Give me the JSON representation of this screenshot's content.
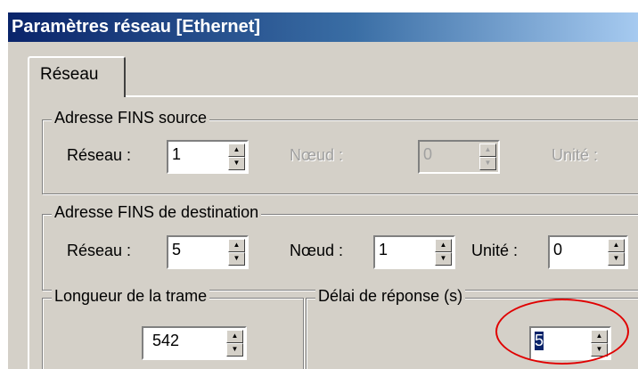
{
  "window": {
    "title": "Paramètres réseau [Ethernet]"
  },
  "tabs": [
    {
      "label": "Réseau",
      "active": true
    }
  ],
  "source_group": {
    "legend": "Adresse FINS source",
    "network_label": "Réseau :",
    "network_value": "1",
    "node_label": "Nœud :",
    "node_value": "0",
    "unit_label": "Unité :"
  },
  "dest_group": {
    "legend": "Adresse FINS de destination",
    "network_label": "Réseau :",
    "network_value": "5",
    "node_label": "Nœud :",
    "node_value": "1",
    "unit_label": "Unité :",
    "unit_value": "0"
  },
  "frame_group": {
    "legend": "Longueur de la trame",
    "value": "542"
  },
  "response_group": {
    "legend": "Délai de réponse (s)",
    "value": "5"
  },
  "spinner": {
    "up_glyph": "▲",
    "down_glyph": "▼"
  },
  "colors": {
    "titlebar_start": "#0a246a",
    "titlebar_end": "#a6caf0",
    "dialog_bg": "#d4d0c8",
    "highlight_ellipse": "#e00000"
  }
}
